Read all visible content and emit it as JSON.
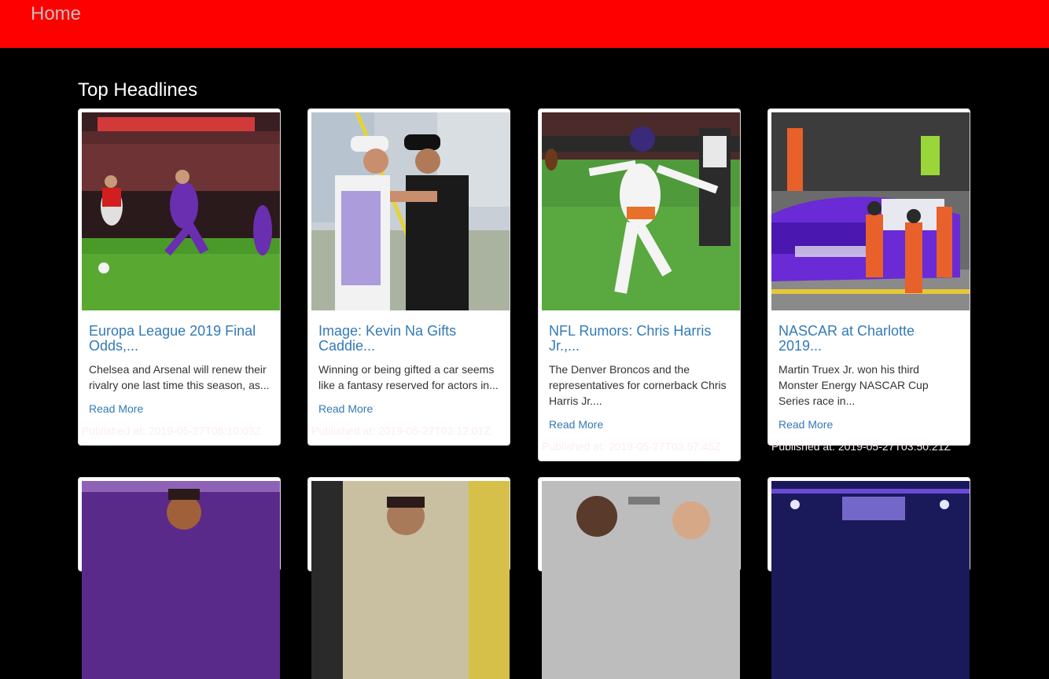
{
  "nav": {
    "home_label": "Home",
    "bg_color": "#ff0000"
  },
  "section": {
    "title": "Top Headlines"
  },
  "articles": [
    {
      "title": "Europa League 2019 Final Odds,...",
      "description": "Chelsea and Arsenal will renew their rivalry one last time this season, as...",
      "read_more": "Read More",
      "published": "Published at: 2019-05-27T06:10:09Z",
      "image": "soccer-players-on-pitch"
    },
    {
      "title": "Image: Kevin Na Gifts Caddie...",
      "description": "Winning or being gifted a car seems like a fantasy reserved for actors in...",
      "read_more": "Read More",
      "published": "Published at: 2019-05-27T03:12:01Z",
      "image": "golfer-hugging-caddie"
    },
    {
      "title": "NFL Rumors: Chris Harris Jr.,...",
      "description": "The Denver Broncos and the representatives for cornerback Chris Harris Jr....",
      "read_more": "Read More",
      "published": "Published at: 2019-05-27T03:57:45Z",
      "image": "football-player-celebrating"
    },
    {
      "title": "NASCAR at Charlotte 2019...",
      "description": "Martin Truex Jr. won his third Monster Energy NASCAR Cup Series race in...",
      "read_more": "Read More",
      "published": "Published at: 2019-05-27T03:50:21Z",
      "image": "nascar-pit-stop"
    }
  ],
  "second_row_images": [
    "performer-on-stage",
    "soccer-player-closeup",
    "men-at-event",
    "concert-stage-lights"
  ]
}
